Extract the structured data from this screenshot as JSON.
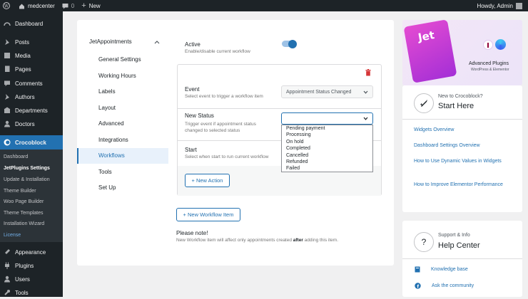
{
  "adminbar": {
    "site": "medcenter",
    "comments": "0",
    "new": "New",
    "howdy": "Howdy, Admin"
  },
  "sidebar": {
    "items": [
      {
        "label": "Dashboard",
        "icon": "dashboard-icon"
      },
      {
        "label": "Posts",
        "icon": "pin-icon"
      },
      {
        "label": "Media",
        "icon": "media-icon"
      },
      {
        "label": "Pages",
        "icon": "pages-icon"
      },
      {
        "label": "Comments",
        "icon": "comment-icon"
      },
      {
        "label": "Authors",
        "icon": "pin-icon"
      },
      {
        "label": "Departments",
        "icon": "building-icon"
      },
      {
        "label": "Doctors",
        "icon": "person-icon"
      },
      {
        "label": "Crocoblock",
        "icon": "crocoblock-icon"
      }
    ],
    "sub": [
      "Dashboard",
      "JetPlugins Settings",
      "Update & Installation",
      "Theme Builder",
      "Woo Page Builder",
      "Theme Templates",
      "Installation Wizard",
      "License"
    ],
    "bottom": [
      {
        "label": "Appearance",
        "icon": "brush-icon"
      },
      {
        "label": "Plugins",
        "icon": "plug-icon"
      },
      {
        "label": "Users",
        "icon": "user-icon"
      },
      {
        "label": "Tools",
        "icon": "wrench-icon"
      }
    ]
  },
  "nav": {
    "group": "JetAppointments",
    "items": [
      "General Settings",
      "Working Hours",
      "Labels",
      "Layout",
      "Advanced",
      "Integrations",
      "Workflows",
      "Tools",
      "Set Up"
    ]
  },
  "workflow": {
    "active_label": "Active",
    "active_desc": "Enable/disable current workflow",
    "event_label": "Event",
    "event_desc": "Select event to trigger a workflow item",
    "event_value": "Appointment Status Changed",
    "status_label": "New Status",
    "status_desc1": "Trigger event if appointment status",
    "status_desc2": "changed to selected status",
    "status_value": "",
    "start_label": "Start",
    "start_desc": "Select when start to run current workflow",
    "options": [
      "Pending payment",
      "Processing",
      "On hold",
      "Completed",
      "Cancelled",
      "Refunded",
      "Failed"
    ],
    "new_action": "+ New Action",
    "new_item": "+ New Workflow Item",
    "note_title": "Please note!",
    "note_a": "New Workflow item will affect only appointments created ",
    "note_b": "after",
    "note_c": " adding this item."
  },
  "banner": {
    "line1": "Advanced Plugins",
    "line2": "WordPress & Elementor"
  },
  "start": {
    "small": "New to Crocoblock?",
    "big": "Start Here",
    "links": [
      "Widgets Overview",
      "Dashboard Settings Overview",
      "How to Use Dynamic Values in Widgets",
      "How to Improve Elementor Performance"
    ]
  },
  "help": {
    "small": "Support & Info",
    "big": "Help Center",
    "links": [
      "Knowledge base",
      "Ask the community"
    ]
  },
  "colors": {
    "wp_dark": "#1d2327",
    "accent": "#2271b1",
    "toggle": "#2271b1",
    "delete": "#d63638"
  }
}
